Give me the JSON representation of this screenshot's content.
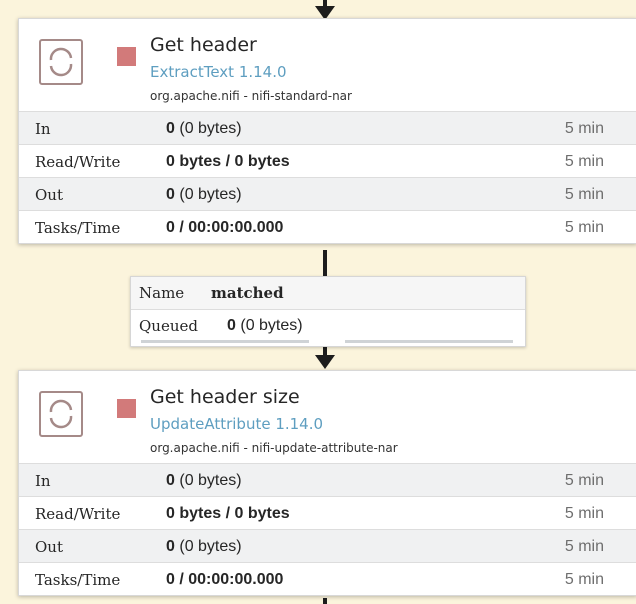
{
  "processors": [
    {
      "name": "Get header",
      "type": "ExtractText 1.14.0",
      "bundle": "org.apache.nifi - nifi-standard-nar",
      "stats": [
        {
          "label": "In",
          "count": "0",
          "detail": "(0 bytes)",
          "time": "5 min"
        },
        {
          "label": "Read/Write",
          "value": "0 bytes / 0 bytes",
          "time": "5 min"
        },
        {
          "label": "Out",
          "count": "0",
          "detail": "(0 bytes)",
          "time": "5 min"
        },
        {
          "label": "Tasks/Time",
          "value": "0 / 00:00:00.000",
          "time": "5 min"
        }
      ]
    },
    {
      "name": "Get header size",
      "type": "UpdateAttribute 1.14.0",
      "bundle": "org.apache.nifi - nifi-update-attribute-nar",
      "stats": [
        {
          "label": "In",
          "count": "0",
          "detail": "(0 bytes)",
          "time": "5 min"
        },
        {
          "label": "Read/Write",
          "value": "0 bytes / 0 bytes",
          "time": "5 min"
        },
        {
          "label": "Out",
          "count": "0",
          "detail": "(0 bytes)",
          "time": "5 min"
        },
        {
          "label": "Tasks/Time",
          "value": "0 / 00:00:00.000",
          "time": "5 min"
        }
      ]
    }
  ],
  "connection": {
    "name_label": "Name",
    "name_value": "matched",
    "queued_label": "Queued",
    "queued_count": "0",
    "queued_detail": "(0 bytes)"
  },
  "colors": {
    "canvas": "#fbf4dc",
    "status_stopped": "#d27a7a",
    "type_text": "#5e9ec0"
  },
  "icons": {
    "processor": "processor-icon",
    "status": "stopped-status-icon"
  }
}
